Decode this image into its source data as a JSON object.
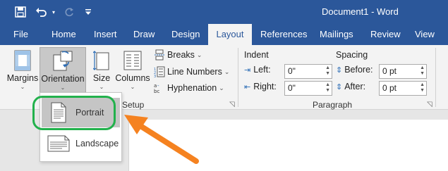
{
  "titlebar": {
    "document_title": "Document1  -  Word",
    "qat": {
      "save_icon": "save-icon",
      "undo_icon": "undo-icon",
      "redo_icon": "redo-icon",
      "customize_icon": "customize-qat-icon"
    }
  },
  "tabs": [
    {
      "label": "File"
    },
    {
      "label": "Home"
    },
    {
      "label": "Insert"
    },
    {
      "label": "Draw"
    },
    {
      "label": "Design"
    },
    {
      "label": "Layout",
      "active": true
    },
    {
      "label": "References"
    },
    {
      "label": "Mailings"
    },
    {
      "label": "Review"
    },
    {
      "label": "View"
    }
  ],
  "ribbon": {
    "page_setup": {
      "margins": "Margins",
      "orientation": "Orientation",
      "size": "Size",
      "columns": "Columns",
      "breaks": "Breaks",
      "line_numbers": "Line Numbers",
      "hyphenation": "Hyphenation",
      "group_label_fragment": "Setup"
    },
    "paragraph": {
      "indent_header": "Indent",
      "left_label": "Left:",
      "left_value": "0\"",
      "right_label": "Right:",
      "right_value": "0\"",
      "spacing_header": "Spacing",
      "before_label": "Before:",
      "before_value": "0 pt",
      "after_label": "After:",
      "after_value": "0 pt",
      "group_label": "Paragraph"
    }
  },
  "orientation_menu": {
    "items": [
      {
        "label": "Portrait",
        "selected": true
      },
      {
        "label": "Landscape",
        "selected": false
      }
    ]
  },
  "colors": {
    "title_blue": "#2b579a",
    "highlight_green": "#22b14c",
    "arrow_orange": "#f58220"
  }
}
